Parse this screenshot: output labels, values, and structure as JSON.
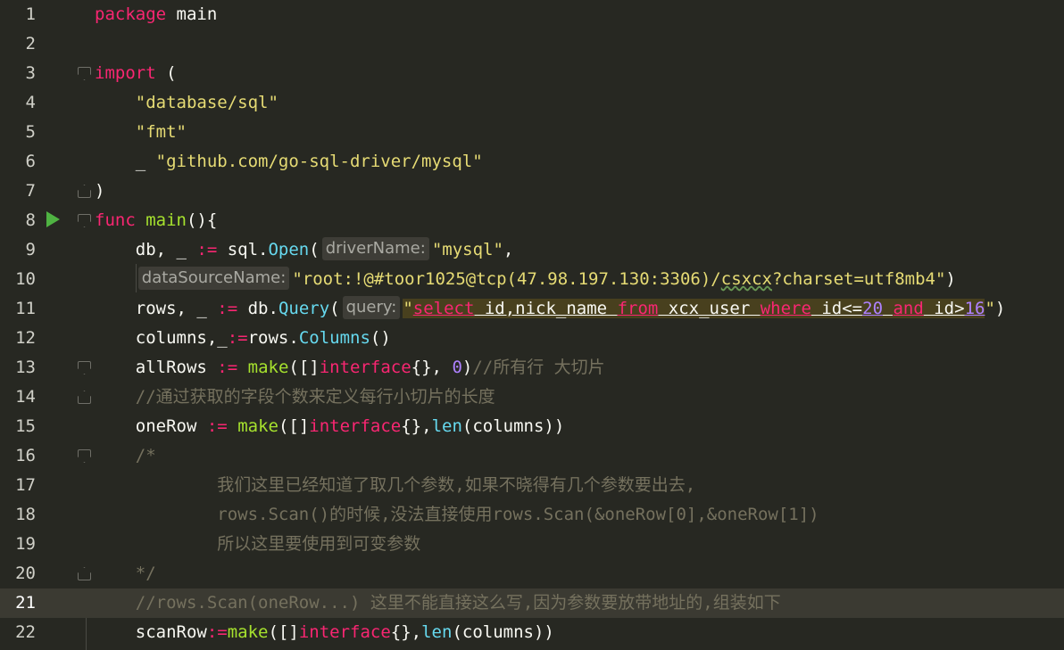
{
  "editor": {
    "lines": [
      {
        "n": "1",
        "t": [
          "package",
          " main"
        ]
      },
      {
        "n": "2"
      },
      {
        "n": "3",
        "t": [
          "import",
          " ("
        ]
      },
      {
        "n": "4",
        "t": [
          "    ",
          "\"database/sql\""
        ]
      },
      {
        "n": "5",
        "t": [
          "    ",
          "\"fmt\""
        ]
      },
      {
        "n": "6",
        "t": [
          "    _ ",
          "\"github.com/go-sql-driver/mysql\""
        ]
      },
      {
        "n": "7",
        "t": [
          ")"
        ]
      },
      {
        "n": "8",
        "t": [
          "func ",
          "main",
          "(){"
        ]
      },
      {
        "n": "9",
        "t": [
          "    db, _ ",
          ":=",
          " sql.",
          "Open",
          "(",
          "driverName:",
          "\"mysql\"",
          ","
        ]
      },
      {
        "n": "10",
        "t": [
          "    ",
          "dataSourceName:",
          "\"root:!@#toor1025@tcp(47.98.197.130:3306)/",
          "csxcx",
          "?charset=utf8mb4\"",
          ")"
        ]
      },
      {
        "n": "11",
        "t": [
          "    rows, _ ",
          ":=",
          " db.",
          "Query",
          "(",
          "query:",
          "\"",
          "select",
          " id,nick_name ",
          "from",
          " xcx_user ",
          "where",
          " id<=",
          "20",
          " ",
          "and",
          " id>",
          "16",
          "\"",
          ")"
        ]
      },
      {
        "n": "12",
        "t": [
          "    columns,_",
          ":=",
          "rows.",
          "Columns",
          "()"
        ]
      },
      {
        "n": "13",
        "t": [
          "    allRows ",
          ":=",
          " ",
          "make",
          "([]",
          "interface",
          "{}, ",
          "0",
          ")",
          "//所有行 大切片"
        ]
      },
      {
        "n": "14",
        "t": [
          "    ",
          "//通过获取的字段个数来定义每行小切片的长度"
        ]
      },
      {
        "n": "15",
        "t": [
          "    oneRow ",
          ":=",
          " ",
          "make",
          "([]",
          "interface",
          "{},",
          "len",
          "(columns))"
        ]
      },
      {
        "n": "16",
        "t": [
          "    ",
          "/*"
        ]
      },
      {
        "n": "17",
        "t": [
          "            ",
          "我们这里已经知道了取几个参数,如果不晓得有几个参数要出去,"
        ]
      },
      {
        "n": "18",
        "t": [
          "            ",
          "rows.Scan()的时候,没法直接使用rows.Scan(&oneRow[0],&oneRow[1])"
        ]
      },
      {
        "n": "19",
        "t": [
          "            ",
          "所以这里要使用到可变参数"
        ]
      },
      {
        "n": "20",
        "t": [
          "    ",
          "*/"
        ]
      },
      {
        "n": "21",
        "t": [
          "    ",
          "//rows.Scan(oneRow...) 这里不能直接这么写,因为参数要放带地址的,组装如下"
        ]
      },
      {
        "n": "22",
        "t": [
          "    scanRow",
          ":=",
          "make",
          "([]",
          "interface",
          "{},",
          "len",
          "(columns))"
        ]
      }
    ]
  },
  "icons": {
    "run": "run-gutter-icon",
    "fold": "fold-marker-icon"
  },
  "colors": {
    "background": "#272822",
    "keyword": "#f92672",
    "function": "#a6e22e",
    "string": "#e6db74",
    "comment": "#75715e",
    "number": "#ae81ff",
    "builtin": "#66d9ef"
  }
}
